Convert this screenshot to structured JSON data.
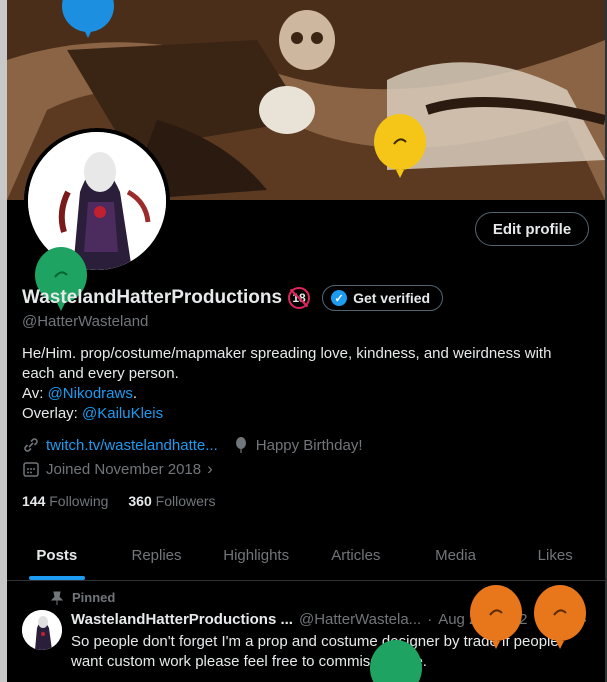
{
  "banner": {
    "description_icon": "costume-props-photo"
  },
  "profile": {
    "display_name": "WastelandHatterProductions",
    "age_badge": "18",
    "get_verified_label": "Get verified",
    "handle": "@HatterWasteland",
    "edit_profile_label": "Edit profile",
    "bio_line1": "He/Him. prop/costume/mapmaker spreading love, kindness, and weirdness with each and every person.",
    "bio_av_prefix": "Av: ",
    "bio_av_link": "@Nikodraws",
    "bio_av_suffix": ".",
    "bio_overlay_prefix": "Overlay: ",
    "bio_overlay_link": "@KailuKleis",
    "website": "twitch.tv/wastelandhatte...",
    "birthday": "Happy Birthday!",
    "joined": "Joined November 2018",
    "following_count": "144",
    "following_label": "Following",
    "followers_count": "360",
    "followers_label": "Followers"
  },
  "tabs": [
    {
      "label": "Posts",
      "active": true
    },
    {
      "label": "Replies",
      "active": false
    },
    {
      "label": "Highlights",
      "active": false
    },
    {
      "label": "Articles",
      "active": false
    },
    {
      "label": "Media",
      "active": false
    },
    {
      "label": "Likes",
      "active": false
    }
  ],
  "pinned_post": {
    "pinned_label": "Pinned",
    "author_name": "WastelandHatterProductions ...",
    "author_handle": "@HatterWastela...",
    "separator": "·",
    "date": "Aug 26, 2022",
    "text": "So people don't forget I'm a prop and costume designer by trade if people want custom work please feel free to commission me."
  },
  "colors": {
    "accent": "#1d9bf0",
    "background": "#000000",
    "secondary_text": "#71767b",
    "balloon_blue": "#1d8fe0",
    "balloon_yellow": "#f5c518",
    "balloon_green": "#1ea362",
    "balloon_orange": "#e8761a"
  }
}
